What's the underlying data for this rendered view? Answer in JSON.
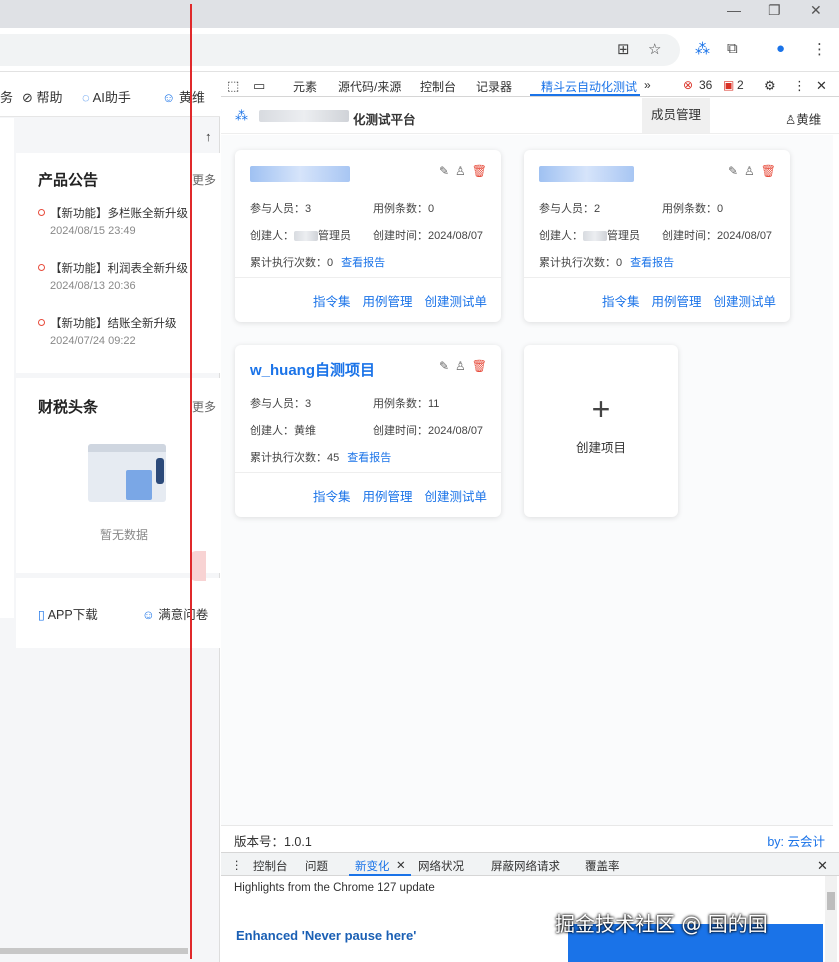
{
  "browser": {
    "window_controls": {
      "minimize": "—",
      "restore": "❐",
      "close": "✕"
    },
    "address_icons": [
      "translate-icon",
      "star-icon",
      "extension-icon",
      "puzzle-icon",
      "profile-icon",
      "menu-icon"
    ]
  },
  "left_page": {
    "topnav": [
      "务",
      "帮助",
      "AI助手",
      "黄维"
    ],
    "announcements": {
      "title": "产品公告",
      "more": "更多",
      "items": [
        {
          "text": "【新功能】多栏账全新升级",
          "date": "2024/08/15 23:49"
        },
        {
          "text": "【新功能】利润表全新升级",
          "date": "2024/08/13 20:36"
        },
        {
          "text": "【新功能】结账全新升级",
          "date": "2024/07/24 09:22"
        }
      ]
    },
    "tax_news": {
      "title": "财税头条",
      "more": "更多",
      "empty": "暂无数据"
    },
    "bottom_links": {
      "app_download": "APP下载",
      "survey": "满意问卷"
    }
  },
  "devtools": {
    "tabs": [
      "元素",
      "源代码/来源",
      "控制台",
      "记录器",
      "精斗云自动化测试",
      "»"
    ],
    "active_tab": "精斗云自动化测试",
    "error_count": "36",
    "warning_count": "2",
    "drawer_tabs": [
      "控制台",
      "问题",
      "新变化",
      "网络状况",
      "屏蔽网络请求",
      "覆盖率"
    ],
    "drawer_active": "新变化",
    "highlights": "Highlights from the Chrome 127 update",
    "enhanced": "Enhanced 'Never pause here'"
  },
  "app": {
    "title_suffix": "化测试平台",
    "member_management": "成员管理",
    "user": "黄维",
    "version": "版本号：1.0.1",
    "byline": "by: 云会计",
    "create_project": "创建项目",
    "projects": [
      {
        "name": "",
        "participants": "参与人员：3",
        "case_count": "用例条数：0",
        "creator": "创建人：",
        "creator_suffix": "管理员",
        "created_at": "创建时间：2024/08/07",
        "exec_count": "累计执行次数：0",
        "report": "查看报告"
      },
      {
        "name": "",
        "participants": "参与人员：2",
        "case_count": "用例条数：0",
        "creator": "创建人：",
        "creator_suffix": "管理员",
        "created_at": "创建时间：2024/08/07",
        "exec_count": "累计执行次数：0",
        "report": "查看报告"
      },
      {
        "name": "w_huang自测项目",
        "participants": "参与人员：3",
        "case_count": "用例条数：11",
        "creator": "创建人：黄维",
        "creator_suffix": "",
        "created_at": "创建时间：2024/08/07",
        "exec_count": "累计执行次数：45",
        "report": "查看报告"
      }
    ],
    "card_actions": [
      "指令集",
      "用例管理",
      "创建测试单"
    ]
  },
  "watermark": "掘金技术社区 @ 国的国"
}
